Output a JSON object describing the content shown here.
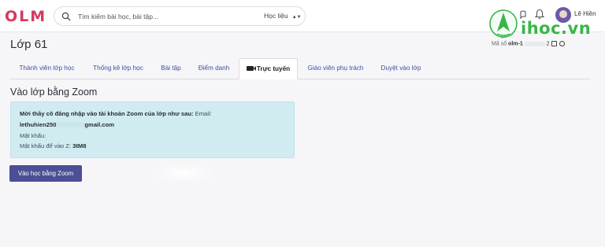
{
  "app": {
    "logo": "OLM",
    "brand_color": "#d6385c",
    "accent_color": "#4b4f95"
  },
  "search": {
    "placeholder": "Tìm kiếm bài học, bài tập...",
    "icon": "search-icon",
    "category_selected": "Học liệu"
  },
  "user": {
    "name": "Lê Hiền",
    "icons": [
      "bell-icon",
      "avatar"
    ]
  },
  "watermark": {
    "text": "ihoc.vn",
    "sub": "ihoc.vn",
    "color": "#39b54a"
  },
  "page": {
    "title": "Lớp 61",
    "code_label": "Mã",
    "code_partial": "số",
    "code_value": "olm-1",
    "code_suffix": "2"
  },
  "tabs": [
    {
      "label": "Thành viên lớp học"
    },
    {
      "label": "Thống kê lớp học"
    },
    {
      "label": "Bài tập"
    },
    {
      "label": "Điểm danh"
    },
    {
      "label": "Trực tuyến",
      "active": true,
      "icon": "camera-icon"
    },
    {
      "label": "Giáo viên phụ trách"
    },
    {
      "label": "Duyệt vào lớp"
    }
  ],
  "zoom": {
    "section_title": "Vào lớp bằng Zoom",
    "intro": "Mời thầy cô đăng nhập vào tài khoản Zoom của lớp như sau:",
    "email_label": "Email:",
    "email_start": "lethuhien250",
    "email_end": "gmail.com",
    "password_label": "Mật khẩu:",
    "meeting_password_label": "Mật khẩu để vào Z:",
    "meeting_password_value": "3tM8",
    "button_label": "Vào học bằng Zoom"
  }
}
